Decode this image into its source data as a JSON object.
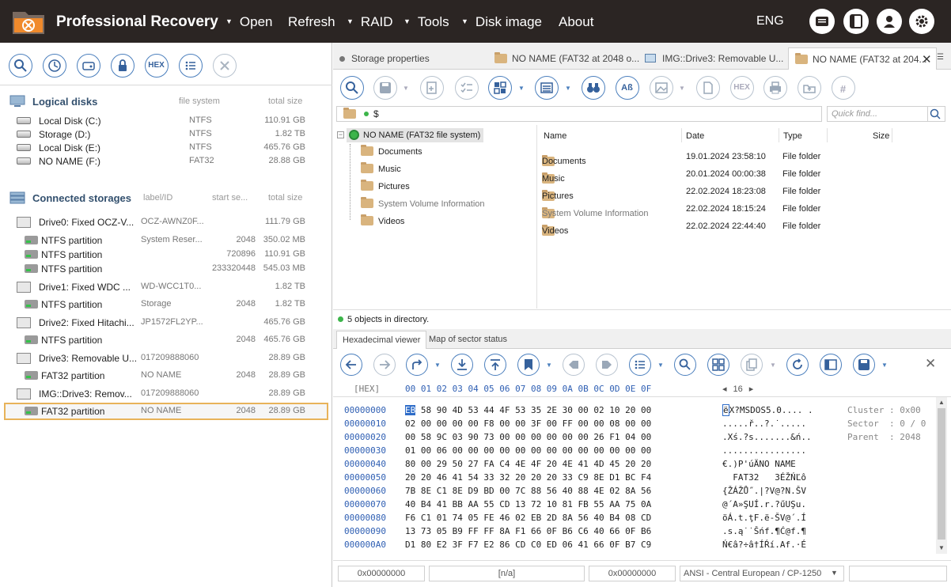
{
  "app": {
    "title": "Professional Recovery",
    "menu": [
      {
        "label": "Open",
        "tri": true
      },
      {
        "label": "Refresh",
        "tri": false
      },
      {
        "label": "RAID",
        "tri": true
      },
      {
        "label": "Tools",
        "tri": true
      },
      {
        "label": "Disk image",
        "tri": true
      },
      {
        "label": "About",
        "tri": false
      }
    ],
    "language": "ENG"
  },
  "logical": {
    "title": "Logical disks",
    "col_fs": "file system",
    "col_size": "total size",
    "items": [
      {
        "name": "Local Disk (C:)",
        "fs": "NTFS",
        "size": "110.91 GB"
      },
      {
        "name": "Storage (D:)",
        "fs": "NTFS",
        "size": "1.82 TB"
      },
      {
        "name": "Local Disk (E:)",
        "fs": "NTFS",
        "size": "465.76 GB"
      },
      {
        "name": "NO NAME (F:)",
        "fs": "FAT32",
        "size": "28.88 GB"
      }
    ]
  },
  "storages": {
    "title": "Connected storages",
    "col_label": "label/ID",
    "col_start": "start se...",
    "col_size": "total size",
    "items": [
      {
        "type": "drive",
        "name": "Drive0: Fixed OCZ-V...",
        "label": "OCZ-AWNZ0F...",
        "start": "",
        "size": "111.79 GB"
      },
      {
        "type": "part",
        "name": "NTFS partition",
        "label": "System Reser...",
        "start": "2048",
        "size": "350.02 MB"
      },
      {
        "type": "part",
        "name": "NTFS partition",
        "label": "",
        "start": "720896",
        "size": "110.91 GB"
      },
      {
        "type": "part",
        "name": "NTFS partition",
        "label": "",
        "start": "233320448",
        "size": "545.03 MB"
      },
      {
        "type": "drive",
        "name": "Drive1: Fixed WDC ...",
        "label": "WD-WCC1T0...",
        "start": "",
        "size": "1.82 TB"
      },
      {
        "type": "part",
        "name": "NTFS partition",
        "label": "Storage",
        "start": "2048",
        "size": "1.82 TB"
      },
      {
        "type": "drive",
        "name": "Drive2: Fixed Hitachi...",
        "label": "JP1572FL2YP...",
        "start": "",
        "size": "465.76 GB"
      },
      {
        "type": "part",
        "name": "NTFS partition",
        "label": "",
        "start": "2048",
        "size": "465.76 GB"
      },
      {
        "type": "drive",
        "name": "Drive3: Removable U...",
        "label": "017209888060",
        "start": "",
        "size": "28.89 GB"
      },
      {
        "type": "part",
        "name": "FAT32 partition",
        "label": "NO NAME",
        "start": "2048",
        "size": "28.89 GB"
      },
      {
        "type": "drive",
        "name": "IMG::Drive3: Remov...",
        "label": "017209888060",
        "start": "",
        "size": "28.89 GB"
      },
      {
        "type": "part",
        "name": "FAT32 partition",
        "label": "NO NAME",
        "start": "2048",
        "size": "28.89 GB"
      }
    ]
  },
  "tabs": [
    "Storage properties",
    "NO NAME (FAT32 at 2048 o...",
    "IMG::Drive3: Removable U...",
    "NO NAME (FAT32 at 204..."
  ],
  "toolbar": {
    "hex": "HEX"
  },
  "path": "$",
  "find_placeholder": "Quick find...",
  "tree": {
    "root": "NO NAME (FAT32 file system)",
    "children": [
      "Documents",
      "Music",
      "Pictures",
      "System Volume Information",
      "Videos"
    ]
  },
  "list": {
    "cols": [
      "Name",
      "Date",
      "Type",
      "Size"
    ],
    "rows": [
      {
        "name": "Documents",
        "date": "19.01.2024 23:58:10",
        "type": "File folder",
        "dim": false
      },
      {
        "name": "Music",
        "date": "20.01.2024 00:00:38",
        "type": "File folder",
        "dim": false
      },
      {
        "name": "Pictures",
        "date": "22.02.2024 18:23:08",
        "type": "File folder",
        "dim": false
      },
      {
        "name": "System Volume Information",
        "date": "22.02.2024 18:15:24",
        "type": "File folder",
        "dim": true
      },
      {
        "name": "Videos",
        "date": "22.02.2024 22:44:40",
        "type": "File folder",
        "dim": false
      }
    ]
  },
  "status": "5 objects in directory.",
  "bottom_tabs": [
    "Hexadecimal viewer",
    "Map of sector status"
  ],
  "hex": {
    "header_label": "[HEX]",
    "header_cols": "00 01 02 03 04 05 06 07 08 09 0A 0B 0C 0D 0E 0F",
    "width": "16",
    "addresses": "00000000\n00000010\n00000020\n00000030\n00000040\n00000050\n00000060\n00000070\n00000080\n00000090\n000000A0",
    "first_byte": "EB",
    "bytes_first_rest": " 58 90 4D 53 44 4F 53 35 2E 30 00 02 10 20 00",
    "bytes_rest": "02 00 00 00 00 F8 00 00 3F 00 FF 00 00 08 00 00\n00 58 9C 03 90 73 00 00 00 00 00 00 26 F1 04 00\n01 00 06 00 00 00 00 00 00 00 00 00 00 00 00 00\n80 00 29 50 27 FA C4 4E 4F 20 4E 41 4D 45 20 20\n20 20 46 41 54 33 32 20 20 20 33 C9 8E D1 BC F4\n7B 8E C1 8E D9 BD 00 7C 88 56 40 88 4E 02 8A 56\n40 B4 41 BB AA 55 CD 13 72 10 81 FB 55 AA 75 0A\nF6 C1 01 74 05 FE 46 02 EB 2D 8A 56 40 B4 08 CD\n13 73 05 B9 FF FF 8A F1 66 0F B6 C6 40 66 0F B6\nD1 80 E2 3F F7 E2 86 CD C0 ED 06 41 66 0F B7 C9",
    "ascii_first": "ë",
    "ascii_first_rest": "X?MSDOS5.0.... .",
    "ascii_rest": ".....ř..?.˙.....\n.Xś.?s.......&ń..\n................\n€.)P'úÄNO NAME\n  FAT32   3ÉŽŃĽô\n{ŽÁŽŮ˝.|?V@?N.ŠV\n@´A»ŞUÍ.r.?űUŞu.\nöÁ.t.ţF.ë-ŠV@´.Í\n.s.ą˙˙Šńf.¶Ć@f.¶\nŃ€â?÷â†ÍŔí.Af.·É",
    "info": "Cluster : 0x00\nSector  : 0 / 0\nParent  : 2048"
  },
  "bottombar": [
    "0x00000000",
    "[n/a]",
    "0x00000000",
    "ANSI - Central European / CP-1250"
  ]
}
